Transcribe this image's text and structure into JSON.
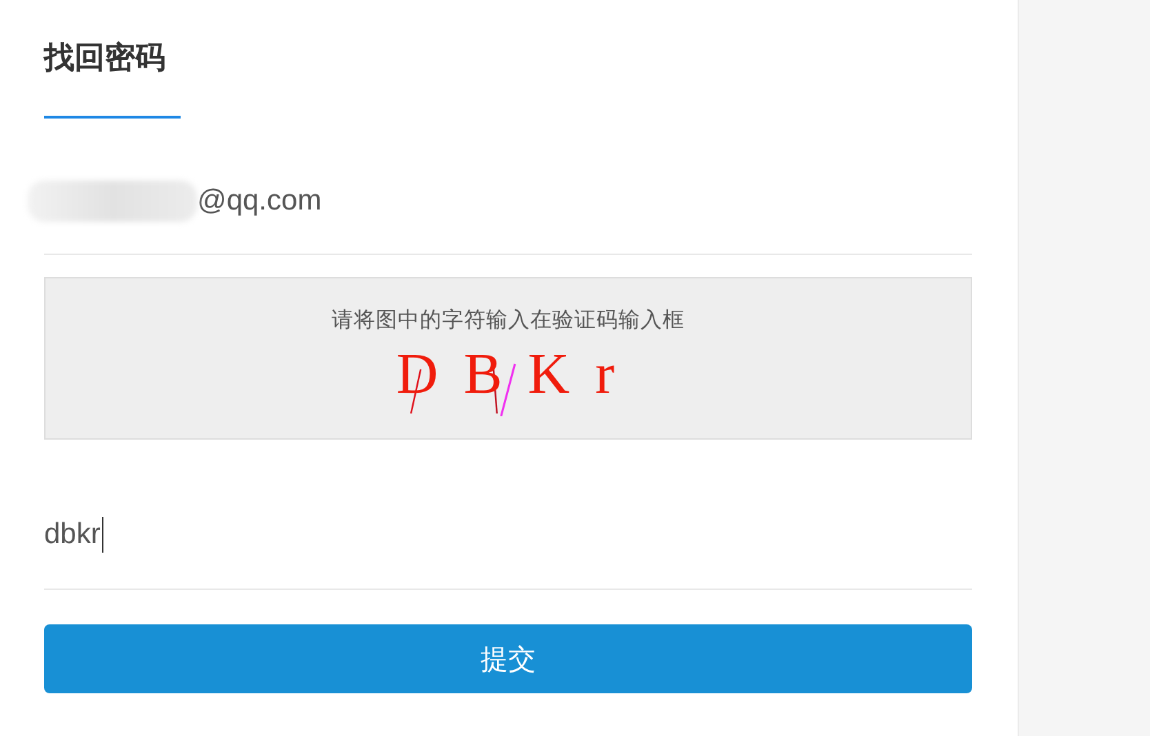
{
  "title": "找回密码",
  "account": {
    "value": "@qq.com",
    "redacted": true
  },
  "captcha": {
    "hint": "请将图中的字符输入在验证码输入框",
    "text": "D B K r"
  },
  "code_field": {
    "value": "dbkr",
    "focused": true
  },
  "submit_button": "提交"
}
